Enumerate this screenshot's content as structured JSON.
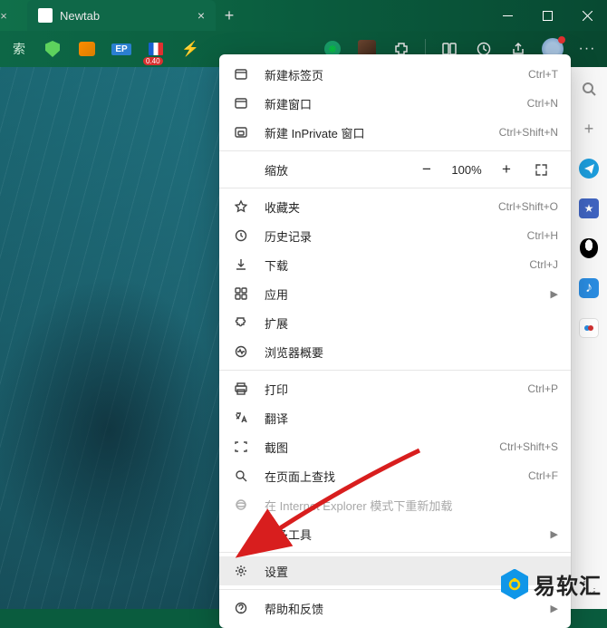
{
  "tab": {
    "title": "Newtab"
  },
  "toolbar": {
    "search_label": "索",
    "badge_value": "0.40"
  },
  "menu": {
    "new_tab": {
      "label": "新建标签页",
      "shortcut": "Ctrl+T"
    },
    "new_window": {
      "label": "新建窗口",
      "shortcut": "Ctrl+N"
    },
    "new_inprivate": {
      "label": "新建 InPrivate 窗口",
      "shortcut": "Ctrl+Shift+N"
    },
    "zoom": {
      "label": "缩放",
      "value": "100%"
    },
    "favorites": {
      "label": "收藏夹",
      "shortcut": "Ctrl+Shift+O"
    },
    "history": {
      "label": "历史记录",
      "shortcut": "Ctrl+H"
    },
    "downloads": {
      "label": "下载",
      "shortcut": "Ctrl+J"
    },
    "apps": {
      "label": "应用"
    },
    "extensions": {
      "label": "扩展"
    },
    "essentials": {
      "label": "浏览器概要"
    },
    "print": {
      "label": "打印",
      "shortcut": "Ctrl+P"
    },
    "translate": {
      "label": "翻译"
    },
    "screenshot": {
      "label": "截图",
      "shortcut": "Ctrl+Shift+S"
    },
    "find": {
      "label": "在页面上查找",
      "shortcut": "Ctrl+F"
    },
    "ie_mode": {
      "label": "在 Internet Explorer 模式下重新加载"
    },
    "more_tools": {
      "label": "更多工具"
    },
    "settings": {
      "label": "设置"
    },
    "help": {
      "label": "帮助和反馈"
    }
  },
  "watermark": {
    "text": "易软汇"
  }
}
